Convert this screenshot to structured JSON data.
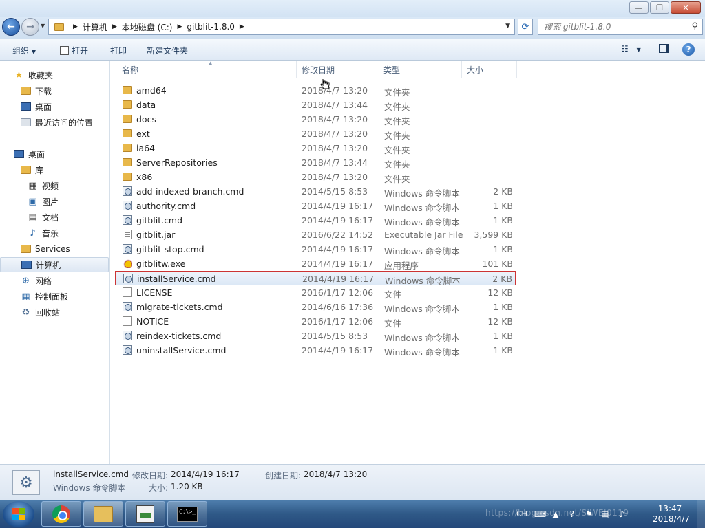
{
  "window": {
    "minimize_icon": "minimize-icon",
    "maximize_icon": "maximize-icon",
    "close_icon": "close-icon"
  },
  "address": {
    "breadcrumbs": [
      "计算机",
      "本地磁盘 (C:)",
      "gitblit-1.8.0"
    ],
    "search_placeholder": "搜索 gitblit-1.8.0"
  },
  "toolbar": {
    "organize": "组织",
    "open": "打开",
    "print": "打印",
    "new_folder": "新建文件夹"
  },
  "nav": {
    "favorites": "收藏夹",
    "downloads": "下载",
    "desktop_fav": "桌面",
    "recent": "最近访问的位置",
    "desktop": "桌面",
    "libraries": "库",
    "videos": "视频",
    "pictures": "图片",
    "documents": "文档",
    "music": "音乐",
    "services": "Services",
    "computer": "计算机",
    "network": "网络",
    "control_panel": "控制面板",
    "recycle_bin": "回收站"
  },
  "columns": {
    "name": "名称",
    "modified": "修改日期",
    "type": "类型",
    "size": "大小"
  },
  "files": [
    {
      "name": "amd64",
      "date": "2018/4/7 13:20",
      "type": "文件夹",
      "size": "",
      "icon": "folder"
    },
    {
      "name": "data",
      "date": "2018/4/7 13:44",
      "type": "文件夹",
      "size": "",
      "icon": "folder"
    },
    {
      "name": "docs",
      "date": "2018/4/7 13:20",
      "type": "文件夹",
      "size": "",
      "icon": "folder"
    },
    {
      "name": "ext",
      "date": "2018/4/7 13:20",
      "type": "文件夹",
      "size": "",
      "icon": "folder"
    },
    {
      "name": "ia64",
      "date": "2018/4/7 13:20",
      "type": "文件夹",
      "size": "",
      "icon": "folder"
    },
    {
      "name": "ServerRepositories",
      "date": "2018/4/7 13:44",
      "type": "文件夹",
      "size": "",
      "icon": "folder"
    },
    {
      "name": "x86",
      "date": "2018/4/7 13:20",
      "type": "文件夹",
      "size": "",
      "icon": "folder"
    },
    {
      "name": "add-indexed-branch.cmd",
      "date": "2014/5/15 8:53",
      "type": "Windows 命令脚本",
      "size": "2 KB",
      "icon": "cmd"
    },
    {
      "name": "authority.cmd",
      "date": "2014/4/19 16:17",
      "type": "Windows 命令脚本",
      "size": "1 KB",
      "icon": "cmd"
    },
    {
      "name": "gitblit.cmd",
      "date": "2014/4/19 16:17",
      "type": "Windows 命令脚本",
      "size": "1 KB",
      "icon": "cmd"
    },
    {
      "name": "gitblit.jar",
      "date": "2016/6/22 14:52",
      "type": "Executable Jar File",
      "size": "3,599 KB",
      "icon": "jar"
    },
    {
      "name": "gitblit-stop.cmd",
      "date": "2014/4/19 16:17",
      "type": "Windows 命令脚本",
      "size": "1 KB",
      "icon": "cmd"
    },
    {
      "name": "gitblitw.exe",
      "date": "2014/4/19 16:17",
      "type": "应用程序",
      "size": "101 KB",
      "icon": "exe"
    },
    {
      "name": "installService.cmd",
      "date": "2014/4/19 16:17",
      "type": "Windows 命令脚本",
      "size": "2 KB",
      "icon": "cmd"
    },
    {
      "name": "LICENSE",
      "date": "2016/1/17 12:06",
      "type": "文件",
      "size": "12 KB",
      "icon": "doc"
    },
    {
      "name": "migrate-tickets.cmd",
      "date": "2014/6/16 17:36",
      "type": "Windows 命令脚本",
      "size": "1 KB",
      "icon": "cmd"
    },
    {
      "name": "NOTICE",
      "date": "2016/1/17 12:06",
      "type": "文件",
      "size": "12 KB",
      "icon": "doc"
    },
    {
      "name": "reindex-tickets.cmd",
      "date": "2014/5/15 8:53",
      "type": "Windows 命令脚本",
      "size": "1 KB",
      "icon": "cmd"
    },
    {
      "name": "uninstallService.cmd",
      "date": "2014/4/19 16:17",
      "type": "Windows 命令脚本",
      "size": "1 KB",
      "icon": "cmd"
    }
  ],
  "details": {
    "filename": "installService.cmd",
    "modified_label": "修改日期:",
    "modified_value": "2014/4/19 16:17",
    "created_label": "创建日期:",
    "created_value": "2018/4/7 13:20",
    "type": "Windows 命令脚本",
    "size_label": "大小:",
    "size_value": "1.20 KB"
  },
  "taskbar": {
    "lang": "CH",
    "time": "13:47",
    "date": "2018/4/7",
    "watermark": "https://blog.csdn.net/SIWEI0119",
    "cmd_text": "C:\\>_"
  },
  "colors": {
    "selection_border": "#cc3333",
    "taskbar": "#2f5987"
  }
}
